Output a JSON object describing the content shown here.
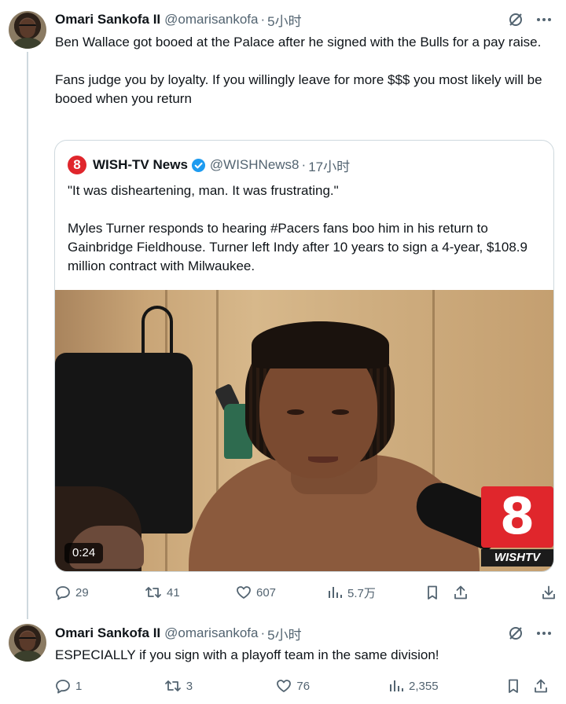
{
  "tweets": [
    {
      "name": "Omari Sankofa II",
      "handle": "@omarisankofa",
      "separator": "·",
      "time": "5小时",
      "paragraphs": [
        "Ben Wallace got booed at the Palace after he signed with the Bulls for a pay raise.",
        "Fans judge you by loyalty. If you willingly leave for more $$$ you most likely will be booed when you return"
      ],
      "quote": {
        "logo_text": "8",
        "name": "WISH-TV News",
        "handle": "@WISHNews8",
        "separator": "·",
        "time": "17小时",
        "paragraphs": [
          "\"It was disheartening, man. It was frustrating.\"",
          "Myles Turner responds to hearing #Pacers fans boo him in his return to Gainbridge Fieldhouse. Turner left Indy after 10 years to sign a 4-year, $108.9 million contract with Milwaukee."
        ],
        "video": {
          "duration": "0:24",
          "station_number": "8",
          "station_label": "WISHTV"
        }
      },
      "actions": {
        "replies": "29",
        "reposts": "41",
        "likes": "607",
        "views": "5.7万"
      }
    },
    {
      "name": "Omari Sankofa II",
      "handle": "@omarisankofa",
      "separator": "·",
      "time": "5小时",
      "paragraphs": [
        "ESPECIALLY if you sign with a playoff team in the same division!"
      ],
      "actions": {
        "replies": "1",
        "reposts": "3",
        "likes": "76",
        "views": "2,355"
      }
    }
  ],
  "colors": {
    "text": "#0f1419",
    "secondary": "#536471",
    "border": "#cfd9de",
    "verified": "#1d9bf0",
    "station_red": "#e0262c"
  },
  "icons": [
    "grok-icon",
    "more-icon",
    "reply-icon",
    "repost-icon",
    "like-icon",
    "views-icon",
    "bookmark-icon",
    "share-icon",
    "verified-badge-icon"
  ]
}
